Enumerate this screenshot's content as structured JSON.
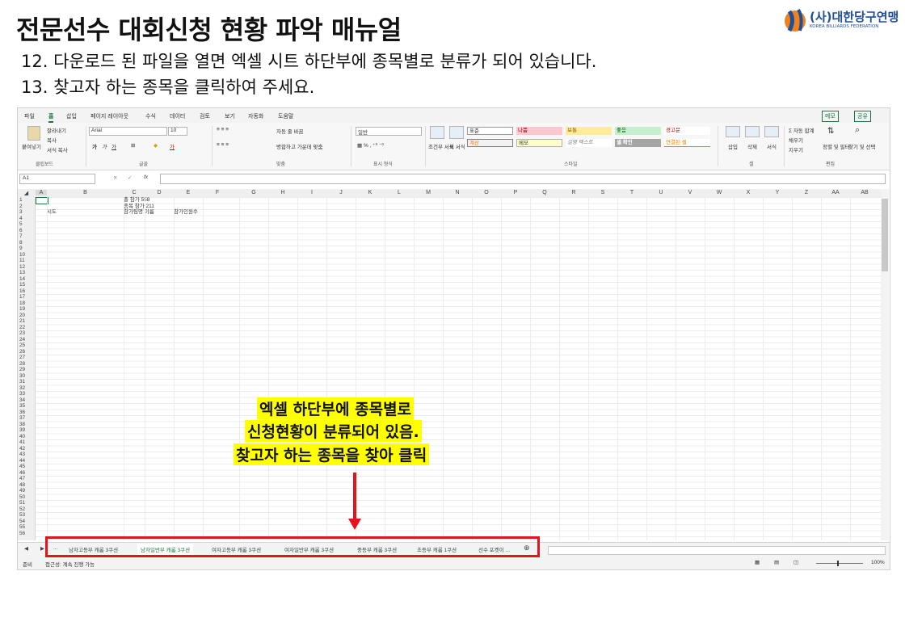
{
  "slide": {
    "title": "전문선수 대회신청 현황 파악 매뉴얼",
    "step12": "12. 다운로드 된 파일을 열면 엑셀 시트 하단부에 종목별로 분류가 되어 있습니다.",
    "step13": "13. 찾고자 하는 종목을 클릭하여 주세요."
  },
  "logo": {
    "name": "(사)대한당구연맹",
    "sub": "KOREA BILLIARDS FEDERATION"
  },
  "excel": {
    "menu": [
      "파일",
      "홈",
      "삽입",
      "페이지 레이아웃",
      "수식",
      "데이터",
      "검토",
      "보기",
      "자동화",
      "도움말"
    ],
    "menu_right": [
      "메모",
      "공유"
    ],
    "ribbon": {
      "paste": "붙여넣기",
      "cut": "잘라내기",
      "copy": "복사",
      "format_painter": "서식 복사",
      "font_name": "Arial",
      "font_size": "10",
      "wrap_text": "자동 줄 바꿈",
      "merge_center": "병합하고 가운데 맞춤",
      "number_format": "일반",
      "conditional": "조건부 서식",
      "table": "표 서식",
      "styles": [
        "표준",
        "나쁨",
        "보통",
        "좋음",
        "경고문",
        "계산",
        "메모",
        "설명 텍스트",
        "셀 확인",
        "연결된 셀"
      ],
      "insert": "삽입",
      "delete": "삭제",
      "format": "서식",
      "autosum": "자동 합계",
      "fill": "채우기",
      "clear": "지우기",
      "sort_filter": "정렬 및 필터",
      "find_select": "찾기 및 선택",
      "groups": [
        "클립보드",
        "글꼴",
        "맞춤",
        "표시 형식",
        "스타일",
        "셀",
        "편집"
      ]
    },
    "name_box": "A1",
    "columns": [
      "A",
      "B",
      "C",
      "D",
      "E",
      "F",
      "G",
      "H",
      "I",
      "J",
      "K",
      "L",
      "M",
      "N",
      "O",
      "P",
      "Q",
      "R",
      "S",
      "T",
      "U",
      "V",
      "W",
      "X",
      "Y",
      "Z",
      "AA",
      "AB"
    ],
    "cells": {
      "c1": "총 참가 558",
      "c2": "종목 참가 211",
      "a3": "시도",
      "c3": "참가팀명 이름",
      "e3": "참가인원수"
    },
    "tabs": [
      "...",
      "남자고등부 캐롬 3쿠션",
      "남자일반부 캐롬 3쿠션",
      "여자고등부 캐롬 3쿠션",
      "여자일반부 캐롬 3쿠션",
      "중등부 캐롬 3쿠션",
      "초등부 캐롬 1쿠션",
      "선수 포켓이 ..."
    ],
    "active_tab_index": 2,
    "status": {
      "ready": "준비",
      "accessibility": "접근성: 계속 진행 가능",
      "zoom": "100%"
    }
  },
  "callout": {
    "line1": "엑셀 하단부에 종목별로",
    "line2": "신청현황이 분류되어 있음.",
    "line3": "찾고자 하는 종목을 찾아 클릭"
  },
  "colors": {
    "excel_green": "#217346",
    "highlight": "#ffff00",
    "red": "#e3141b",
    "logo_blue": "#1f4e9c",
    "logo_orange": "#f0821e"
  }
}
